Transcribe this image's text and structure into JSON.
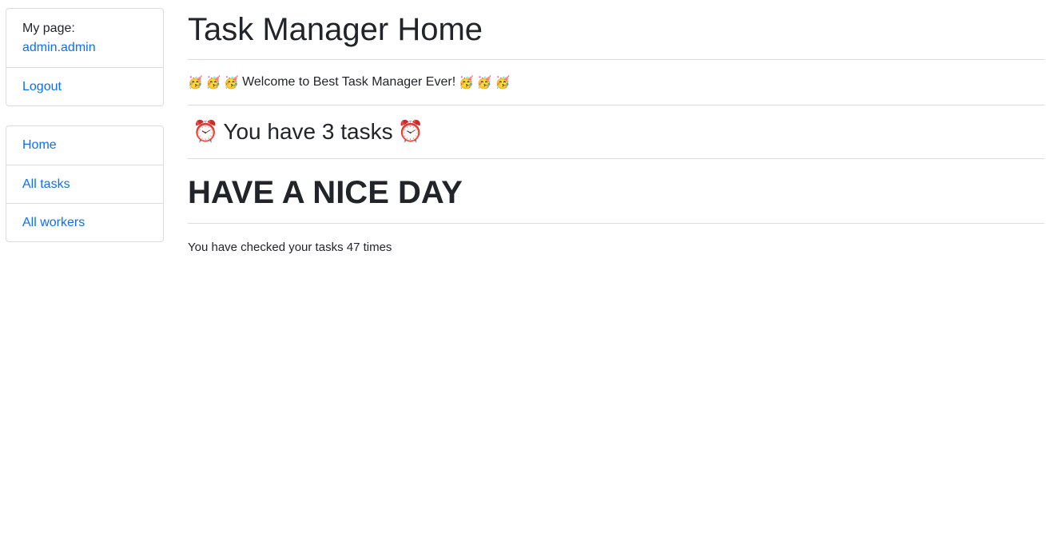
{
  "sidebar": {
    "user_section": {
      "label": "My page:",
      "username": "admin.admin",
      "logout_label": "Logout"
    },
    "nav_items": [
      {
        "label": "Home"
      },
      {
        "label": "All tasks"
      },
      {
        "label": "All workers"
      }
    ]
  },
  "main": {
    "title": "Task Manager Home",
    "welcome": {
      "emoji": "🥳",
      "text": "Welcome to Best Task Manager Ever!"
    },
    "tasks": {
      "emoji": "⏰",
      "text": "You have 3 tasks"
    },
    "nice_day": "HAVE A NICE DAY",
    "checked_text": "You have checked your tasks 47 times"
  },
  "colors": {
    "link": "#0d6efd",
    "text": "#212529",
    "border": "#dcdcdc"
  }
}
